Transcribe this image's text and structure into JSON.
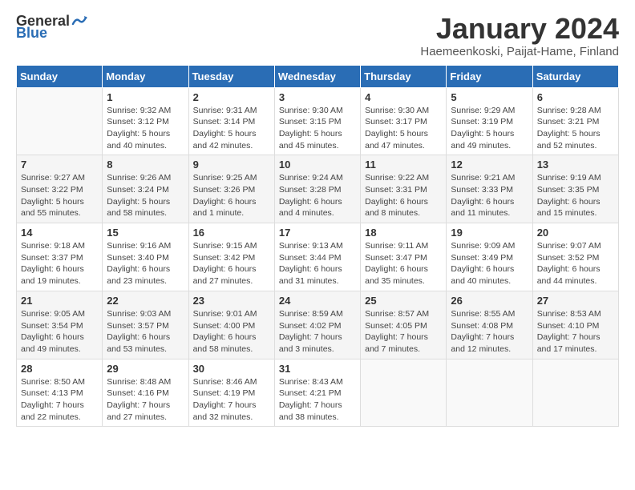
{
  "header": {
    "logo_general": "General",
    "logo_blue": "Blue",
    "title": "January 2024",
    "subtitle": "Haemeenkoski, Paijat-Hame, Finland"
  },
  "days_of_week": [
    "Sunday",
    "Monday",
    "Tuesday",
    "Wednesday",
    "Thursday",
    "Friday",
    "Saturday"
  ],
  "weeks": [
    [
      {
        "day": "",
        "info": ""
      },
      {
        "day": "1",
        "info": "Sunrise: 9:32 AM\nSunset: 3:12 PM\nDaylight: 5 hours\nand 40 minutes."
      },
      {
        "day": "2",
        "info": "Sunrise: 9:31 AM\nSunset: 3:14 PM\nDaylight: 5 hours\nand 42 minutes."
      },
      {
        "day": "3",
        "info": "Sunrise: 9:30 AM\nSunset: 3:15 PM\nDaylight: 5 hours\nand 45 minutes."
      },
      {
        "day": "4",
        "info": "Sunrise: 9:30 AM\nSunset: 3:17 PM\nDaylight: 5 hours\nand 47 minutes."
      },
      {
        "day": "5",
        "info": "Sunrise: 9:29 AM\nSunset: 3:19 PM\nDaylight: 5 hours\nand 49 minutes."
      },
      {
        "day": "6",
        "info": "Sunrise: 9:28 AM\nSunset: 3:21 PM\nDaylight: 5 hours\nand 52 minutes."
      }
    ],
    [
      {
        "day": "7",
        "info": "Sunrise: 9:27 AM\nSunset: 3:22 PM\nDaylight: 5 hours\nand 55 minutes."
      },
      {
        "day": "8",
        "info": "Sunrise: 9:26 AM\nSunset: 3:24 PM\nDaylight: 5 hours\nand 58 minutes."
      },
      {
        "day": "9",
        "info": "Sunrise: 9:25 AM\nSunset: 3:26 PM\nDaylight: 6 hours\nand 1 minute."
      },
      {
        "day": "10",
        "info": "Sunrise: 9:24 AM\nSunset: 3:28 PM\nDaylight: 6 hours\nand 4 minutes."
      },
      {
        "day": "11",
        "info": "Sunrise: 9:22 AM\nSunset: 3:31 PM\nDaylight: 6 hours\nand 8 minutes."
      },
      {
        "day": "12",
        "info": "Sunrise: 9:21 AM\nSunset: 3:33 PM\nDaylight: 6 hours\nand 11 minutes."
      },
      {
        "day": "13",
        "info": "Sunrise: 9:19 AM\nSunset: 3:35 PM\nDaylight: 6 hours\nand 15 minutes."
      }
    ],
    [
      {
        "day": "14",
        "info": "Sunrise: 9:18 AM\nSunset: 3:37 PM\nDaylight: 6 hours\nand 19 minutes."
      },
      {
        "day": "15",
        "info": "Sunrise: 9:16 AM\nSunset: 3:40 PM\nDaylight: 6 hours\nand 23 minutes."
      },
      {
        "day": "16",
        "info": "Sunrise: 9:15 AM\nSunset: 3:42 PM\nDaylight: 6 hours\nand 27 minutes."
      },
      {
        "day": "17",
        "info": "Sunrise: 9:13 AM\nSunset: 3:44 PM\nDaylight: 6 hours\nand 31 minutes."
      },
      {
        "day": "18",
        "info": "Sunrise: 9:11 AM\nSunset: 3:47 PM\nDaylight: 6 hours\nand 35 minutes."
      },
      {
        "day": "19",
        "info": "Sunrise: 9:09 AM\nSunset: 3:49 PM\nDaylight: 6 hours\nand 40 minutes."
      },
      {
        "day": "20",
        "info": "Sunrise: 9:07 AM\nSunset: 3:52 PM\nDaylight: 6 hours\nand 44 minutes."
      }
    ],
    [
      {
        "day": "21",
        "info": "Sunrise: 9:05 AM\nSunset: 3:54 PM\nDaylight: 6 hours\nand 49 minutes."
      },
      {
        "day": "22",
        "info": "Sunrise: 9:03 AM\nSunset: 3:57 PM\nDaylight: 6 hours\nand 53 minutes."
      },
      {
        "day": "23",
        "info": "Sunrise: 9:01 AM\nSunset: 4:00 PM\nDaylight: 6 hours\nand 58 minutes."
      },
      {
        "day": "24",
        "info": "Sunrise: 8:59 AM\nSunset: 4:02 PM\nDaylight: 7 hours\nand 3 minutes."
      },
      {
        "day": "25",
        "info": "Sunrise: 8:57 AM\nSunset: 4:05 PM\nDaylight: 7 hours\nand 7 minutes."
      },
      {
        "day": "26",
        "info": "Sunrise: 8:55 AM\nSunset: 4:08 PM\nDaylight: 7 hours\nand 12 minutes."
      },
      {
        "day": "27",
        "info": "Sunrise: 8:53 AM\nSunset: 4:10 PM\nDaylight: 7 hours\nand 17 minutes."
      }
    ],
    [
      {
        "day": "28",
        "info": "Sunrise: 8:50 AM\nSunset: 4:13 PM\nDaylight: 7 hours\nand 22 minutes."
      },
      {
        "day": "29",
        "info": "Sunrise: 8:48 AM\nSunset: 4:16 PM\nDaylight: 7 hours\nand 27 minutes."
      },
      {
        "day": "30",
        "info": "Sunrise: 8:46 AM\nSunset: 4:19 PM\nDaylight: 7 hours\nand 32 minutes."
      },
      {
        "day": "31",
        "info": "Sunrise: 8:43 AM\nSunset: 4:21 PM\nDaylight: 7 hours\nand 38 minutes."
      },
      {
        "day": "",
        "info": ""
      },
      {
        "day": "",
        "info": ""
      },
      {
        "day": "",
        "info": ""
      }
    ]
  ]
}
